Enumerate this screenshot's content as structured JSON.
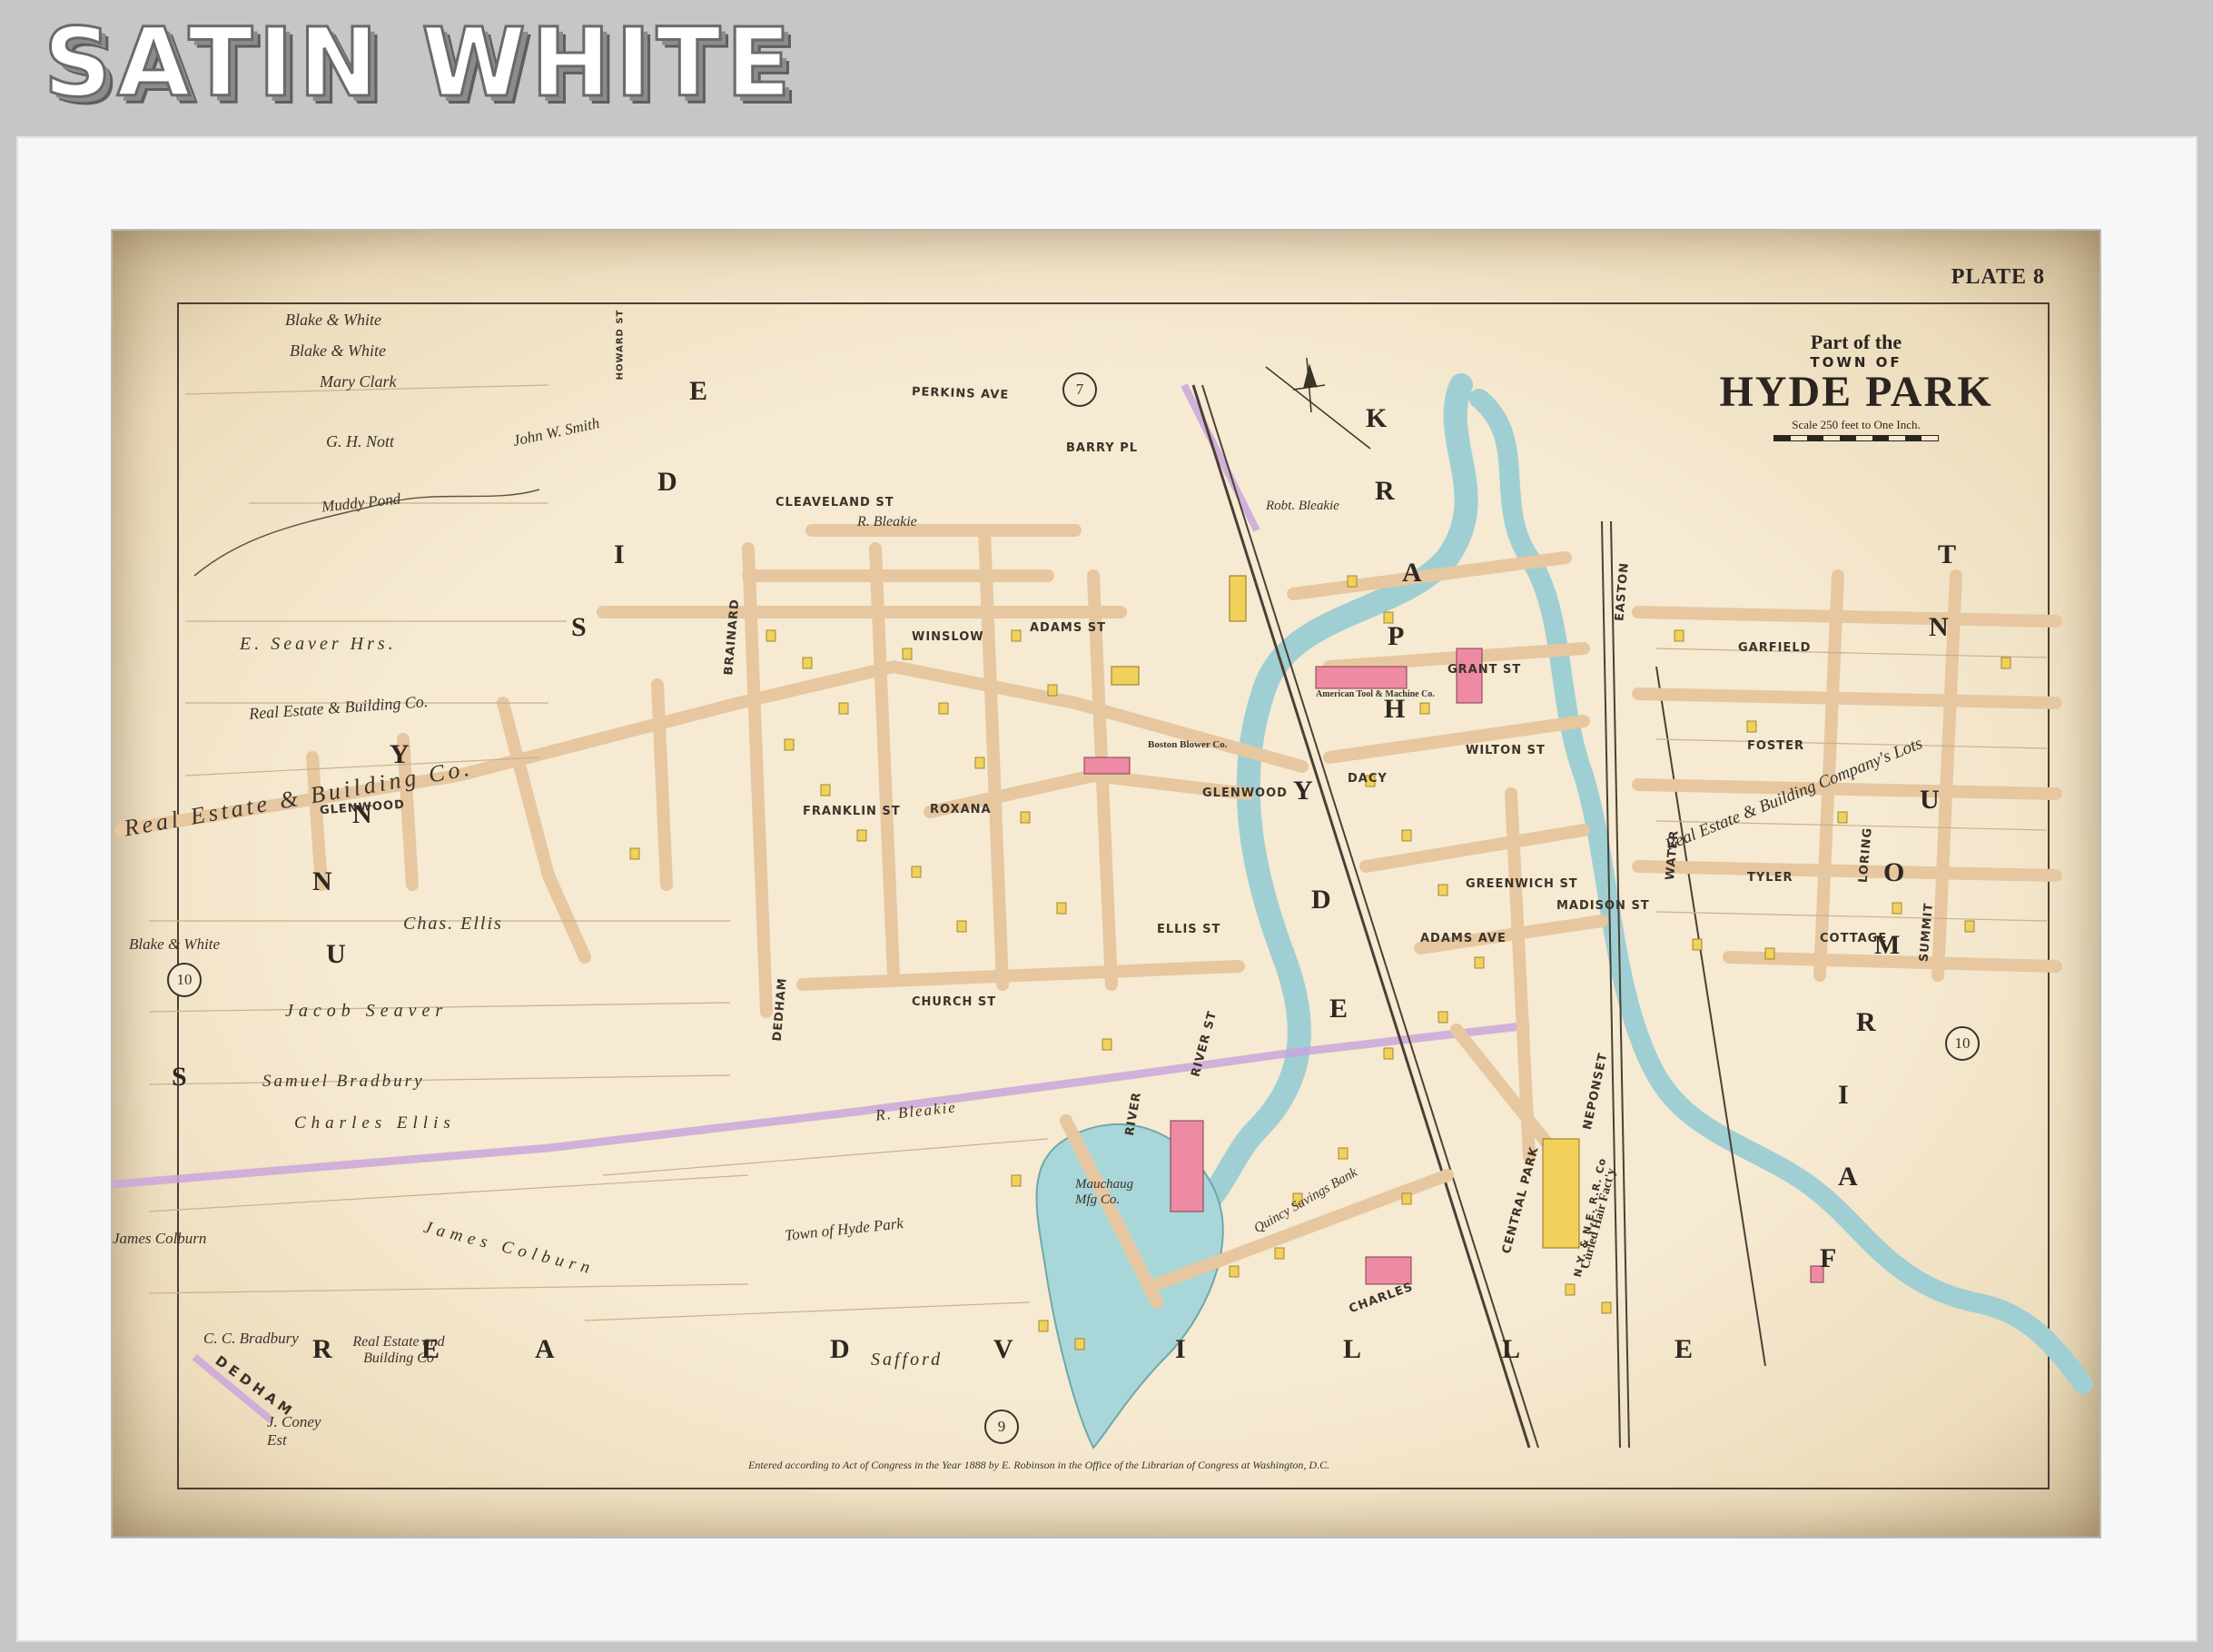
{
  "header": {
    "title": "SATIN WHITE"
  },
  "map": {
    "plate": "PLATE 8",
    "title": {
      "part_of": "Part of the",
      "town_of": "TOWN OF",
      "name": "HYDE PARK",
      "scale": "Scale 250 feet to One Inch."
    },
    "footer_note": "Entered according to Act of Congress in the Year 1888 by E. Robinson in the Office of the Librarian of Congress at Washington, D.C.",
    "district_letters": {
      "hyde": [
        "H",
        "Y",
        "D",
        "E"
      ],
      "park": [
        "P",
        "A",
        "R",
        "K"
      ],
      "readville": [
        "R",
        "E",
        "A",
        "D",
        "V",
        "I",
        "L",
        "L",
        "E"
      ],
      "sunny": [
        "S",
        "U",
        "N",
        "N",
        "Y"
      ],
      "side": [
        "S",
        "I",
        "D",
        "E"
      ],
      "fairmount": [
        "F",
        "A",
        "I",
        "R",
        "M",
        "O",
        "U",
        "N",
        "T"
      ]
    },
    "plate_refs": {
      "top": "7",
      "left": "10",
      "right": "10",
      "bottom": "9"
    },
    "owners": [
      "Blake & White",
      "Blake & White",
      "Mary Clark",
      "G. H. Nott",
      "John W. Smith",
      "Muddy Pond",
      "E. Seaver Hrs.",
      "Real Estate & Building Co.",
      "Real Estate & Building Co.",
      "Blake & White",
      "Chas. Ellis",
      "Jacob Seaver",
      "Samuel Bradbury",
      "Charles Ellis",
      "James Colburn",
      "James Colburn",
      "C. C. Bradbury",
      "Real Estate and Building Co",
      "J. Coney Est",
      "Safford",
      "Town of Hyde Park",
      "Mauchaug Mfg Co.",
      "R. Bleakie",
      "R. Bleakie",
      "Quincy Savings Bank",
      "Robt. Bleakie",
      "Real Estate & Building Company's Lots",
      "Boston Blower Co.",
      "Curled Hair Fact'y",
      "American Tool & Machine Co."
    ],
    "streets": [
      "PERKINS AVE",
      "BARRY PL",
      "CLEAVELAND ST",
      "WINSLOW",
      "ADAMS ST",
      "GLENWOOD",
      "GLENWOOD",
      "FRANKLIN ST",
      "ROXANA",
      "ELLIS ST",
      "CHURCH ST",
      "RIVER ST",
      "GARFIELD",
      "FOSTER",
      "WILTON ST",
      "GRANT ST",
      "DACY",
      "GREENWICH ST",
      "MADISON ST",
      "ADAMS AVE",
      "COTTAGE",
      "TYLER",
      "SUMMIT",
      "LORING",
      "CHARLES",
      "WATER",
      "EASTON",
      "BRAINARD",
      "DEDHAM",
      "CENTRAL PARK",
      "NEPONSET",
      "N.Y. & N.E. R.R. Co",
      "HOWARD ST",
      "DEDHAM",
      "RIVER"
    ]
  }
}
